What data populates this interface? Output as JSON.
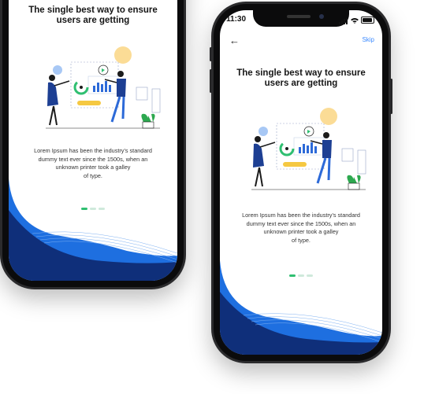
{
  "status_bar": {
    "time": "11:30"
  },
  "nav": {
    "back_icon": "arrow-left-icon",
    "skip_label": "Skip"
  },
  "onboarding": {
    "title_line1": "The single best way to ensure",
    "title_line2": "users are getting",
    "desc_line1": "Lorem Ipsum has been the industry's standard",
    "desc_line2": "dummy text ever since the 1500s, when an",
    "desc_line3": "unknown printer took a galley",
    "desc_line4": "of type.",
    "page_count": 3,
    "active_page": 1
  },
  "colors": {
    "accent_blue": "#1e6fe0",
    "dark_blue": "#0f2f7a",
    "active_dot": "#2fbf71",
    "inactive_dot": "#cfe9db",
    "skip_link": "#3d8bff",
    "sun_yellow": "#fbdc96",
    "plant_green": "#2da84f"
  }
}
